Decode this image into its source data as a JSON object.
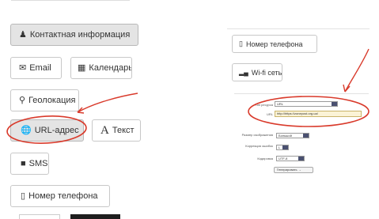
{
  "left_panel": {
    "buttons": [
      {
        "label": "Контактная информация",
        "icon": "person-icon"
      },
      {
        "label": "Email",
        "icon": "envelope-icon"
      },
      {
        "label": "Календарь",
        "icon": "calendar-icon"
      },
      {
        "label": "Геолокация",
        "icon": "map-marker-icon"
      },
      {
        "label": "URL-адрес",
        "icon": "globe-icon"
      },
      {
        "label": "Текст",
        "icon": "text-a-icon"
      },
      {
        "label": "SMS",
        "icon": "chat-icon"
      },
      {
        "label": "Номер телефона",
        "icon": "phone-icon"
      }
    ]
  },
  "right_panel": {
    "buttons": [
      {
        "label": "Номер телефона",
        "icon": "phone-icon"
      },
      {
        "label": "Wi-fi сеть",
        "icon": "signal-bars-icon"
      }
    ],
    "form": {
      "type_label": "Тип ресурса",
      "type_value": "URL",
      "url_label": "URL",
      "url_value": "http://https://zonepost.org.ua/",
      "size_label": "Размер изображения",
      "size_value": "Большой",
      "correction_label": "Коррекция ошибок",
      "correction_value": "L",
      "encoding_label": "Кодировка",
      "encoding_value": "UTF-8",
      "generate_label": "Генерировать →"
    }
  },
  "colors": {
    "annotation": "#d93a2b",
    "active_button": "#e4e4e4",
    "url_field": "#fbf3d6"
  }
}
